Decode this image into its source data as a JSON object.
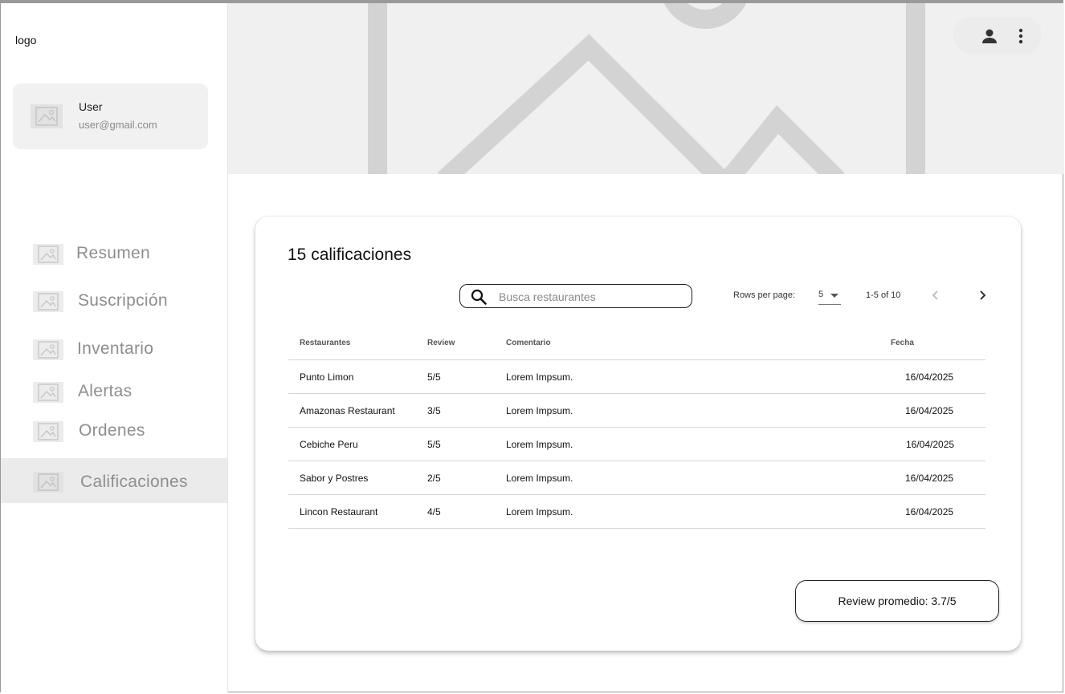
{
  "sidebar": {
    "logo": "logo",
    "user": {
      "name": "User",
      "email": "user@gmail.com"
    },
    "items": [
      {
        "label": "Resumen",
        "active": false
      },
      {
        "label": "Suscripción",
        "active": false
      },
      {
        "label": "Inventario",
        "active": false
      },
      {
        "label": "Alertas",
        "active": false
      },
      {
        "label": "Ordenes",
        "active": false
      },
      {
        "label": "Calificaciones",
        "active": true
      }
    ]
  },
  "header": {
    "icons": [
      "user-icon",
      "more-vertical-icon"
    ]
  },
  "main": {
    "title": "15 calificaciones",
    "search": {
      "placeholder": "Busca restaurantes",
      "value": ""
    },
    "pagination": {
      "rows_per_page_label": "Rows per page:",
      "rows_per_page": "5",
      "range": "1-5 of 10"
    },
    "table": {
      "columns": [
        "Restaurantes",
        "Review",
        "Comentario",
        "Fecha"
      ],
      "rows": [
        [
          "Punto Limon",
          "5/5",
          "Lorem Impsum.",
          "16/04/2025"
        ],
        [
          "Amazonas Restaurant",
          "3/5",
          "Lorem Impsum.",
          "16/04/2025"
        ],
        [
          "Cebiche Peru",
          "5/5",
          "Lorem Impsum.",
          "16/04/2025"
        ],
        [
          "Sabor y Postres",
          "2/5",
          "Lorem Impsum.",
          "16/04/2025"
        ],
        [
          "Lincon Restaurant",
          "4/5",
          "Lorem Impsum.",
          "16/04/2025"
        ]
      ]
    },
    "average_button": "Review promedio: 3.7/5"
  },
  "colors": {
    "sidebar_active": "#ebebeb",
    "hero_placeholder": "#f0f0f0",
    "nav_text": "#8e8e8e"
  }
}
